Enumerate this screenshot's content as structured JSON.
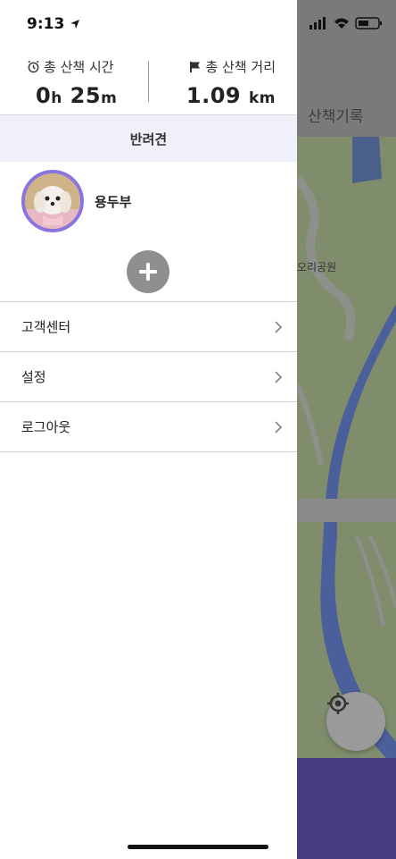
{
  "status_bar": {
    "time": "9:13"
  },
  "background": {
    "title": "산책기록",
    "map_label": "오리공원"
  },
  "stats": {
    "total_time_label": "총 산책 시간",
    "total_time_hours": "0",
    "total_time_hours_unit": "h",
    "total_time_minutes": "25",
    "total_time_minutes_unit": "m",
    "total_distance_label": "총 산책 거리",
    "total_distance_value": "1.09",
    "total_distance_unit": "km"
  },
  "pets_section": {
    "header": "반려견",
    "pets": [
      {
        "name": "용두부"
      }
    ]
  },
  "menu": [
    {
      "label": "고객센터"
    },
    {
      "label": "설정"
    },
    {
      "label": "로그아웃"
    }
  ],
  "colors": {
    "avatar_ring": "#8b74e0",
    "section_header_bg": "#f0f0fb",
    "bottom_bar": "#473a80"
  }
}
